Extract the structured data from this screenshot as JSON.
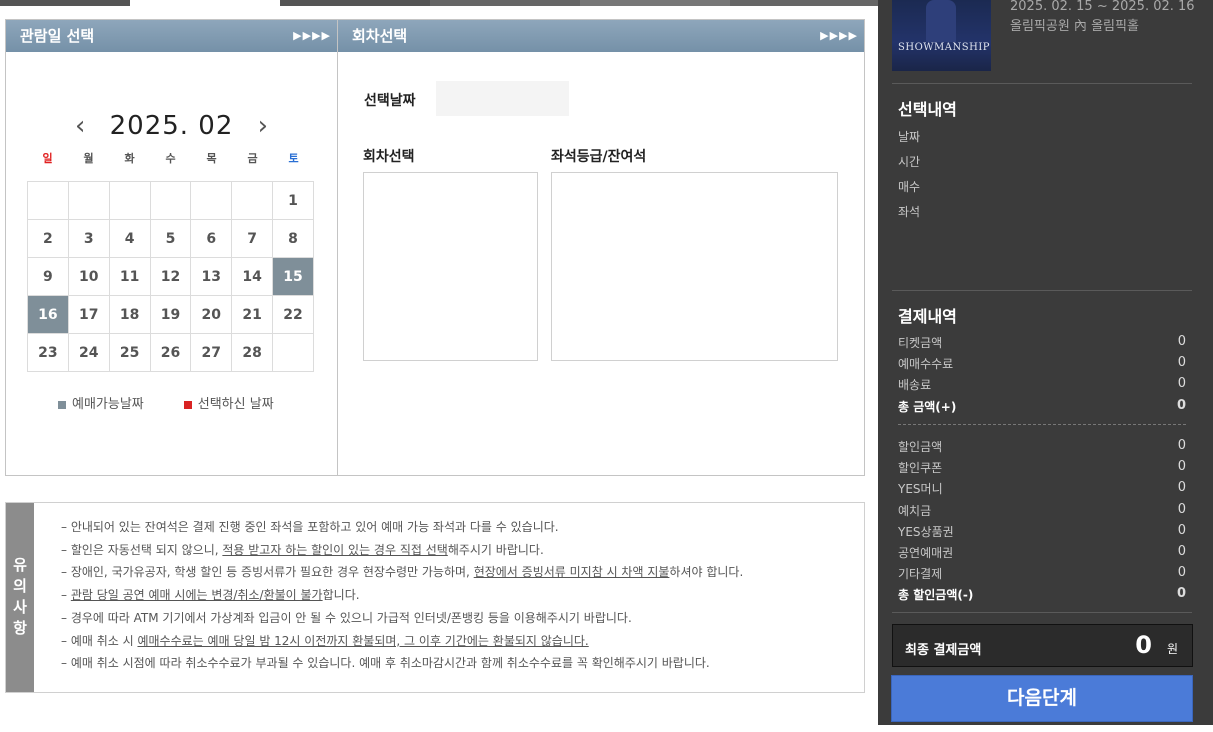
{
  "top_tabs": [
    {
      "color": "#555555"
    },
    {
      "color": "#ffffff"
    },
    {
      "color": "#555555"
    },
    {
      "color": "#666666"
    },
    {
      "color": "#777777"
    },
    {
      "color": "#666666"
    }
  ],
  "date_panel": {
    "title": "관람일 선택",
    "arrows": "▶▶▶▶",
    "prev_icon": "‹",
    "next_icon": "›",
    "year_month": "2025. 02",
    "weekdays": [
      "일",
      "월",
      "화",
      "수",
      "목",
      "금",
      "토"
    ],
    "weekday_colors": [
      "#e02020",
      "#555555",
      "#555555",
      "#555555",
      "#555555",
      "#555555",
      "#2a6fd4"
    ],
    "weeks": [
      [
        "",
        "",
        "",
        "",
        "",
        "",
        "1"
      ],
      [
        "2",
        "3",
        "4",
        "5",
        "6",
        "7",
        "8"
      ],
      [
        "9",
        "10",
        "11",
        "12",
        "13",
        "14",
        "15"
      ],
      [
        "16",
        "17",
        "18",
        "19",
        "20",
        "21",
        "22"
      ],
      [
        "23",
        "24",
        "25",
        "26",
        "27",
        "28",
        ""
      ]
    ],
    "available_days": [
      "15",
      "16"
    ],
    "legend": {
      "available_label": "예매가능날짜",
      "available_color": "#7f8f99",
      "selected_label": "선택하신 날짜",
      "selected_color": "#d92323"
    }
  },
  "round_panel": {
    "title": "회차선택",
    "arrows": "▶▶▶▶",
    "selected_date_label": "선택날짜",
    "selected_date_value": "",
    "round_label": "회차선택",
    "seat_label": "좌석등급/잔여석"
  },
  "notice": {
    "side_label": [
      "유",
      "의",
      "사",
      "항"
    ],
    "items": [
      [
        {
          "t": "– 안내되어 있는 잔여석은 결제 진행 중인 좌석을 포함하고 있어 예매 가능 좌석과 다를 수 있습니다.",
          "u": false
        }
      ],
      [
        {
          "t": "– 할인은 자동선택 되지 않으니, ",
          "u": false
        },
        {
          "t": "적용 받고자 하는 할인이 있는 경우 직접 선택",
          "u": true
        },
        {
          "t": "해주시기 바랍니다.",
          "u": false
        }
      ],
      [
        {
          "t": "– 장애인, 국가유공자, 학생 할인 등 증빙서류가 필요한 경우 현장수령만 가능하며, ",
          "u": false
        },
        {
          "t": "현장에서 증빙서류 미지참 시 차액 지불",
          "u": true
        },
        {
          "t": "하셔야 합니다.",
          "u": false
        }
      ],
      [
        {
          "t": "– ",
          "u": false
        },
        {
          "t": "관람 당일 공연 예매 시에는 변경/취소/환불이 불가",
          "u": true
        },
        {
          "t": "합니다.",
          "u": false
        }
      ],
      [
        {
          "t": "– 경우에 따라 ATM 기기에서 가상계좌 입금이 안 될 수 있으니 가급적 인터넷/폰뱅킹 등을 이용해주시기 바랍니다.",
          "u": false
        }
      ],
      [
        {
          "t": "– 예매 취소 시 ",
          "u": false
        },
        {
          "t": "예매수수료는 예매 당일 밤 12시 이전까지 환불되며, 그 이후 기간에는 환불되지 않습니다.",
          "u": true
        }
      ],
      [
        {
          "t": "– 예매 취소 시점에 따라 취소수수료가 부과될 수 있습니다. 예매 후 취소마감시간과 함께 취소수수료를 꼭 확인해주시기 바랍니다.",
          "u": false
        }
      ]
    ]
  },
  "sidebar": {
    "poster_text": "SHOWMANSHIP",
    "show_dates": "2025. 02. 15 ~ 2025. 02. 16",
    "show_venue": "올림픽공원 內 올림픽홀",
    "selection": {
      "title": "선택내역",
      "fields": [
        "날짜",
        "시간",
        "매수",
        "좌석"
      ]
    },
    "payment": {
      "title": "결제내역",
      "rows_top": [
        {
          "label": "티켓금액",
          "value": "0",
          "bold": false
        },
        {
          "label": "예매수수료",
          "value": "0",
          "bold": false
        },
        {
          "label": "배송료",
          "value": "0",
          "bold": false
        },
        {
          "label": "총 금액(+)",
          "value": "0",
          "bold": true
        }
      ],
      "rows_bottom": [
        {
          "label": "할인금액",
          "value": "0",
          "bold": false
        },
        {
          "label": "할인쿠폰",
          "value": "0",
          "bold": false
        },
        {
          "label": "YES머니",
          "value": "0",
          "bold": false
        },
        {
          "label": "예치금",
          "value": "0",
          "bold": false
        },
        {
          "label": "YES상품권",
          "value": "0",
          "bold": false
        },
        {
          "label": "공연예매권",
          "value": "0",
          "bold": false
        },
        {
          "label": "기타결제",
          "value": "0",
          "bold": false
        },
        {
          "label": "총 할인금액(-)",
          "value": "0",
          "bold": true
        }
      ]
    },
    "final": {
      "label": "최종 결제금액",
      "value": "0",
      "unit": "원"
    },
    "next_button": "다음단계"
  }
}
